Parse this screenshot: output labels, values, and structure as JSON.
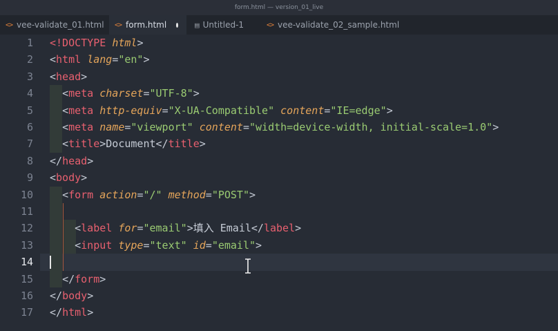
{
  "window": {
    "title": "form.html — version_01_live"
  },
  "tabs": [
    {
      "label": "vee-validate_01.html",
      "icon": "html-file-icon",
      "active": false
    },
    {
      "label": "form.html",
      "icon": "html-file-icon",
      "active": true,
      "dirty": true
    },
    {
      "label": "Untitled-1",
      "icon": "file-icon",
      "active": false
    },
    {
      "label": "vee-validate_02_sample.html",
      "icon": "html-file-icon",
      "active": false
    }
  ],
  "editor": {
    "current_line": 14,
    "line_numbers": [
      "1",
      "2",
      "3",
      "4",
      "5",
      "6",
      "7",
      "8",
      "9",
      "10",
      "11",
      "12",
      "13",
      "14",
      "15",
      "16",
      "17"
    ],
    "lines": [
      {
        "segments": [
          [
            "doc",
            "<!DOCTYPE "
          ],
          [
            "attr",
            "html"
          ],
          [
            "punct",
            ">"
          ]
        ]
      },
      {
        "segments": [
          [
            "punct",
            "<"
          ],
          [
            "tag",
            "html"
          ],
          [
            "text",
            " "
          ],
          [
            "attr",
            "lang"
          ],
          [
            "punct",
            "="
          ],
          [
            "str",
            "\"en\""
          ],
          [
            "punct",
            ">"
          ]
        ]
      },
      {
        "segments": [
          [
            "punct",
            "<"
          ],
          [
            "tag",
            "head"
          ],
          [
            "punct",
            ">"
          ]
        ]
      },
      {
        "segments": [
          [
            "text",
            "  "
          ],
          [
            "punct",
            "<"
          ],
          [
            "tag",
            "meta"
          ],
          [
            "text",
            " "
          ],
          [
            "attr",
            "charset"
          ],
          [
            "punct",
            "="
          ],
          [
            "str",
            "\"UTF-8\""
          ],
          [
            "punct",
            ">"
          ]
        ]
      },
      {
        "segments": [
          [
            "text",
            "  "
          ],
          [
            "punct",
            "<"
          ],
          [
            "tag",
            "meta"
          ],
          [
            "text",
            " "
          ],
          [
            "attr",
            "http-equiv"
          ],
          [
            "punct",
            "="
          ],
          [
            "str",
            "\"X-UA-Compatible\""
          ],
          [
            "text",
            " "
          ],
          [
            "attr",
            "content"
          ],
          [
            "punct",
            "="
          ],
          [
            "str",
            "\"IE=edge\""
          ],
          [
            "punct",
            ">"
          ]
        ]
      },
      {
        "segments": [
          [
            "text",
            "  "
          ],
          [
            "punct",
            "<"
          ],
          [
            "tag",
            "meta"
          ],
          [
            "text",
            " "
          ],
          [
            "attr",
            "name"
          ],
          [
            "punct",
            "="
          ],
          [
            "str",
            "\"viewport\""
          ],
          [
            "text",
            " "
          ],
          [
            "attr",
            "content"
          ],
          [
            "punct",
            "="
          ],
          [
            "str",
            "\"width=device-width, initial-scale=1.0\""
          ],
          [
            "punct",
            ">"
          ]
        ]
      },
      {
        "segments": [
          [
            "text",
            "  "
          ],
          [
            "punct",
            "<"
          ],
          [
            "tag",
            "title"
          ],
          [
            "punct",
            ">"
          ],
          [
            "text",
            "Document"
          ],
          [
            "punct",
            "</"
          ],
          [
            "tag",
            "title"
          ],
          [
            "punct",
            ">"
          ]
        ]
      },
      {
        "segments": [
          [
            "punct",
            "</"
          ],
          [
            "tag",
            "head"
          ],
          [
            "punct",
            ">"
          ]
        ]
      },
      {
        "segments": [
          [
            "punct",
            "<"
          ],
          [
            "tag",
            "body"
          ],
          [
            "punct",
            ">"
          ]
        ]
      },
      {
        "segments": [
          [
            "text",
            "  "
          ],
          [
            "punct",
            "<"
          ],
          [
            "tag",
            "form"
          ],
          [
            "text",
            " "
          ],
          [
            "attr",
            "action"
          ],
          [
            "punct",
            "="
          ],
          [
            "str",
            "\"/\""
          ],
          [
            "text",
            " "
          ],
          [
            "attr",
            "method"
          ],
          [
            "punct",
            "="
          ],
          [
            "str",
            "\"POST\""
          ],
          [
            "punct",
            ">"
          ]
        ]
      },
      {
        "segments": []
      },
      {
        "segments": [
          [
            "text",
            "    "
          ],
          [
            "punct",
            "<"
          ],
          [
            "tag",
            "label"
          ],
          [
            "text",
            " "
          ],
          [
            "attr",
            "for"
          ],
          [
            "punct",
            "="
          ],
          [
            "str",
            "\"email\""
          ],
          [
            "punct",
            ">"
          ],
          [
            "text",
            "填入 Email"
          ],
          [
            "punct",
            "</"
          ],
          [
            "tag",
            "label"
          ],
          [
            "punct",
            ">"
          ]
        ]
      },
      {
        "segments": [
          [
            "text",
            "    "
          ],
          [
            "punct",
            "<"
          ],
          [
            "tag",
            "input"
          ],
          [
            "text",
            " "
          ],
          [
            "attr",
            "type"
          ],
          [
            "punct",
            "="
          ],
          [
            "str",
            "\"text\""
          ],
          [
            "text",
            " "
          ],
          [
            "attr",
            "id"
          ],
          [
            "punct",
            "="
          ],
          [
            "str",
            "\"email\""
          ],
          [
            "punct",
            ">"
          ]
        ]
      },
      {
        "segments": []
      },
      {
        "segments": [
          [
            "text",
            "  "
          ],
          [
            "punct",
            "</"
          ],
          [
            "tag",
            "form"
          ],
          [
            "punct",
            ">"
          ]
        ]
      },
      {
        "segments": [
          [
            "punct",
            "</"
          ],
          [
            "tag",
            "body"
          ],
          [
            "punct",
            ">"
          ]
        ]
      },
      {
        "segments": [
          [
            "punct",
            "</"
          ],
          [
            "tag",
            "html"
          ],
          [
            "punct",
            ">"
          ]
        ]
      }
    ]
  },
  "colors": {
    "background": "#272c35",
    "tag": "#e8606f",
    "attribute": "#e5a55a",
    "string": "#9acb72",
    "text": "#c6ccd6",
    "line_number": "#7c8391"
  }
}
